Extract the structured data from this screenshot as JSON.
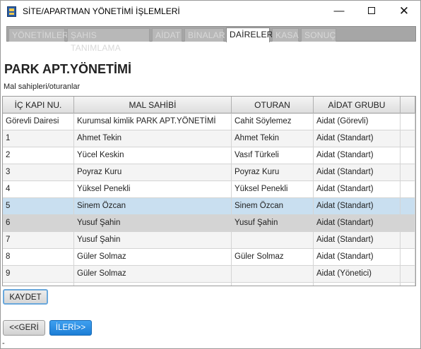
{
  "window": {
    "title": "SİTE/APARTMAN YÖNETİMİ İŞLEMLERİ",
    "minimize_glyph": "—",
    "close_glyph": "✕"
  },
  "tabs": [
    {
      "label": "YÖNETİMLER",
      "active": false
    },
    {
      "label": "ŞAHIS TANIMLAMA",
      "active": false
    },
    {
      "label": "AİDAT",
      "active": false
    },
    {
      "label": "BİNALAR",
      "active": false
    },
    {
      "label": "DAİRELER",
      "active": true
    },
    {
      "label": "KASA",
      "active": false
    },
    {
      "label": "SONUÇ",
      "active": false
    }
  ],
  "page": {
    "title": "PARK APT.YÖNETİMİ",
    "section_label": "Mal sahipleri/oturanlar"
  },
  "table": {
    "columns": [
      "İÇ KAPI NU.",
      "MAL SAHİBİ",
      "OTURAN",
      "AİDAT GRUBU",
      ""
    ],
    "rows": [
      {
        "kapi": "Görevli Dairesi",
        "sahip": "Kurumsal kimlik PARK APT.YÖNETİMİ",
        "oturan": "Cahit Söylemez",
        "aidat": "Aidat  (Görevli)",
        "state": "normal"
      },
      {
        "kapi": "1",
        "sahip": "Ahmet Tekin",
        "oturan": "Ahmet Tekin",
        "aidat": "Aidat  (Standart)",
        "state": "normal"
      },
      {
        "kapi": "2",
        "sahip": "Yücel Keskin",
        "oturan": "Vasıf Türkeli",
        "aidat": "Aidat  (Standart)",
        "state": "normal"
      },
      {
        "kapi": "3",
        "sahip": "Poyraz Kuru",
        "oturan": "Poyraz Kuru",
        "aidat": "Aidat  (Standart)",
        "state": "normal"
      },
      {
        "kapi": "4",
        "sahip": "Yüksel Penekli",
        "oturan": "Yüksel Penekli",
        "aidat": "Aidat  (Standart)",
        "state": "normal"
      },
      {
        "kapi": "5",
        "sahip": "Sinem Özcan",
        "oturan": "Sinem Özcan",
        "aidat": "Aidat  (Standart)",
        "state": "hover"
      },
      {
        "kapi": "6",
        "sahip": "Yusuf Şahin",
        "oturan": "Yusuf Şahin",
        "aidat": "Aidat  (Standart)",
        "state": "selected"
      },
      {
        "kapi": "7",
        "sahip": "Yusuf Şahin",
        "oturan": "",
        "aidat": "Aidat  (Standart)",
        "state": "normal"
      },
      {
        "kapi": "8",
        "sahip": "Güler Solmaz",
        "oturan": "Güler Solmaz",
        "aidat": "Aidat  (Standart)",
        "state": "normal"
      },
      {
        "kapi": "9",
        "sahip": "Güler Solmaz",
        "oturan": "",
        "aidat": "Aidat  (Yönetici)",
        "state": "normal"
      },
      {
        "kapi": "",
        "sahip": "",
        "oturan": "",
        "aidat": "",
        "state": "normal"
      }
    ]
  },
  "buttons": {
    "save": "KAYDET",
    "back": "<<GERİ",
    "next": "İLERİ>>"
  },
  "status": {
    "text": "-"
  },
  "colors": {
    "hover_row": "#c9dff0",
    "selected_row": "#d4d4d4",
    "next_button": "#1c7ed6",
    "focus_ring": "#6aa8dc"
  }
}
